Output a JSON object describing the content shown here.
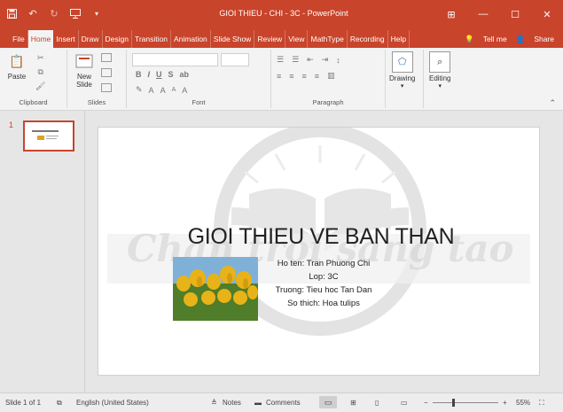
{
  "window": {
    "title": "GIOI THIEU - CHI - 3C  -  PowerPoint",
    "controls": {
      "ribbon_display": "⊞",
      "minimize": "—",
      "maximize": "☐",
      "close": "✕"
    }
  },
  "quick_access": [
    "save-icon",
    "undo-icon",
    "redo-icon",
    "present-icon",
    "customize-icon"
  ],
  "tabs": [
    "File",
    "Home",
    "Insert",
    "Draw",
    "Design",
    "Transition",
    "Animation",
    "Slide Show",
    "Review",
    "View",
    "MathType",
    "Recording",
    "Help"
  ],
  "active_tab": "Home",
  "tabs_right": {
    "tell_me": "Tell me",
    "share": "Share"
  },
  "ribbon": {
    "groups": {
      "clipboard": "Clipboard",
      "slides": "Slides",
      "font": "Font",
      "paragraph": "Paragraph"
    },
    "buttons": {
      "paste": "Paste",
      "new_slide": "New Slide",
      "drawing": "Drawing",
      "editing": "Editing"
    },
    "font_buttons": {
      "bold": "B",
      "italic": "I",
      "underline": "U",
      "strike": "S",
      "shadow": "ab",
      "grow": "A",
      "shrink": "A",
      "clear": "A",
      "color": "A"
    }
  },
  "thumbnails": [
    {
      "number": "1"
    }
  ],
  "slide": {
    "title": "GIOI THIEU VE BAN THAN",
    "info_lines": [
      "Ho ten: Tran Phuong Chi",
      "Lop: 3C",
      "Truong: Tieu hoc Tan Dan",
      "So thich: Hoa tulips"
    ],
    "watermark": "Chan troi sang tao"
  },
  "status": {
    "slide_count": "Slide 1 of 1",
    "language": "English (United States)",
    "notes": "Notes",
    "comments": "Comments",
    "zoom": "55%"
  },
  "colors": {
    "accent": "#c8442b",
    "tulip_yellow": "#e8b318",
    "tulip_green": "#4f7d2a"
  }
}
